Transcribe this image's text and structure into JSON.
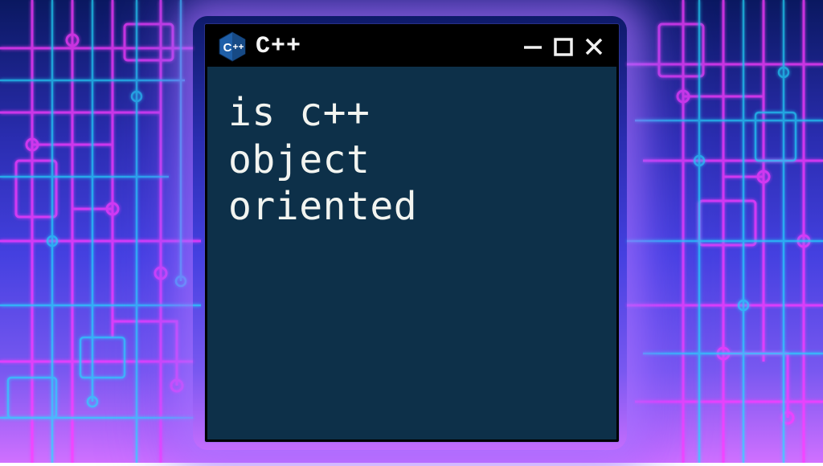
{
  "window": {
    "title": "C++",
    "icon_name": "cpp-hex-icon",
    "controls": {
      "minimize": "minimize",
      "maximize": "maximize",
      "close": "close"
    }
  },
  "content": {
    "text": "is c++\nobject\noriented"
  },
  "colors": {
    "window_bg": "#0d3049",
    "titlebar_bg": "#000000",
    "text": "#f2f4f0",
    "icon_blue": "#1f5fa8",
    "glow": "#b478ff"
  }
}
